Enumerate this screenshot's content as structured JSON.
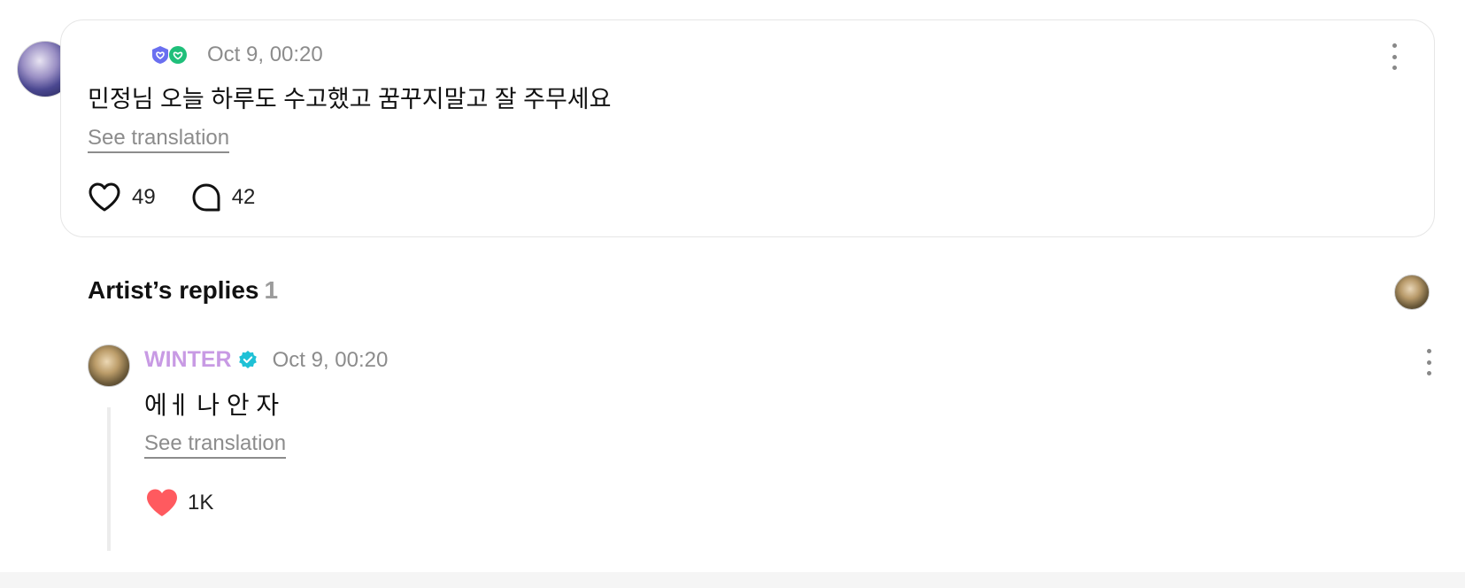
{
  "post": {
    "timestamp": "Oct 9, 00:20",
    "text": "민정님 오늘 하루도 수고했고 꿈꾸지말고 잘 주무세요",
    "see_translation": "See translation",
    "likes": "49",
    "comments": "42",
    "icons": [
      "fan-badge-icon",
      "heart-badge-icon",
      "more-icon",
      "heart-outline-icon",
      "comment-icon"
    ]
  },
  "replies": {
    "title": "Artist’s replies",
    "count": "1"
  },
  "reply": {
    "artist_name": "WINTER",
    "timestamp": "Oct 9, 00:20",
    "text": "에ㅔ 나 안 자",
    "see_translation": "See translation",
    "likes": "1K",
    "icons": [
      "verified-icon",
      "more-icon",
      "heart-filled-icon"
    ]
  },
  "colors": {
    "artist_name": "#c89ae4",
    "verified": "#1fc1d6",
    "liked_heart": "#ff5a5f",
    "muted_text": "#8c8c8c"
  }
}
